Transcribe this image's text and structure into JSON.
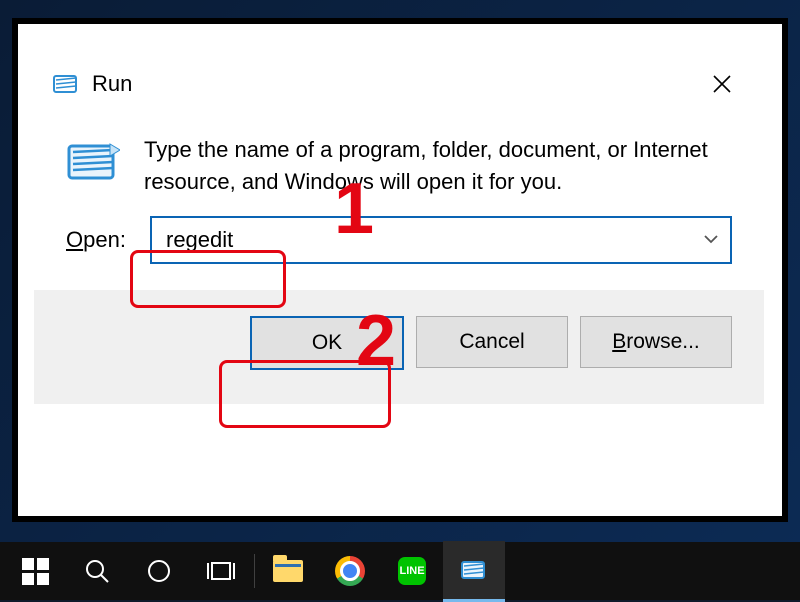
{
  "dialog": {
    "title": "Run",
    "instruction": "Type the name of a program, folder, document, or Internet resource, and Windows will open it for you.",
    "open_label_prefix": "O",
    "open_label_rest": "pen:",
    "input_value": "regedit",
    "ok_label": "OK",
    "cancel_label": "Cancel",
    "browse_prefix": "B",
    "browse_rest": "rowse..."
  },
  "annotations": {
    "step1": "1",
    "step2": "2"
  },
  "taskbar": {
    "line_label": "LINE"
  }
}
